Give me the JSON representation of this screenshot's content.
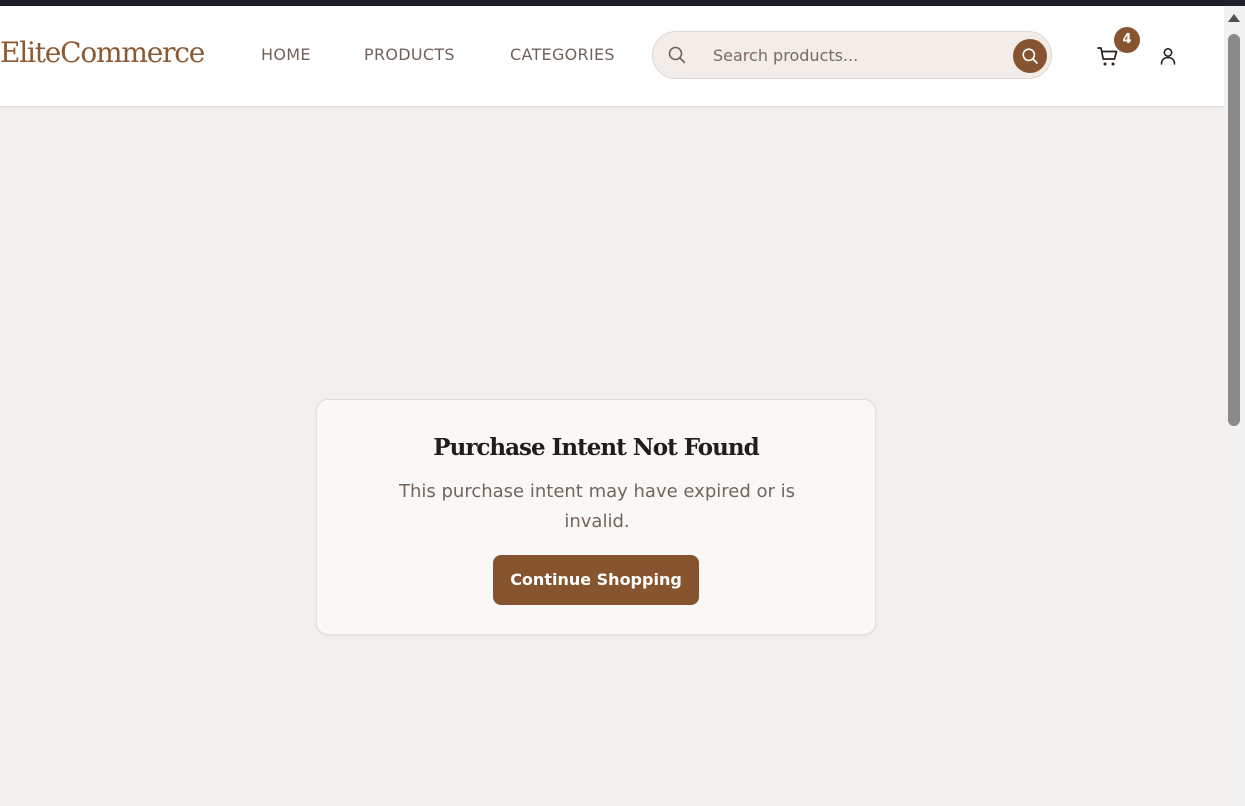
{
  "header": {
    "logo": "EliteCommerce",
    "nav": [
      {
        "label": "HOME"
      },
      {
        "label": "PRODUCTS"
      },
      {
        "label": "CATEGORIES"
      }
    ],
    "search": {
      "placeholder": "Search products...",
      "value": ""
    },
    "cart_count": "4",
    "icons": {
      "search": "search-icon",
      "search_submit": "search-icon",
      "cart": "shopping-cart-icon",
      "user": "user-icon"
    }
  },
  "main": {
    "title": "Purchase Intent Not Found",
    "message": "This purchase intent may have expired or is invalid.",
    "button_label": "Continue Shopping"
  },
  "colors": {
    "brand": "#86552f",
    "background": "#f3efec",
    "card": "#faf8f6",
    "topbar": "#1d1f2b"
  }
}
